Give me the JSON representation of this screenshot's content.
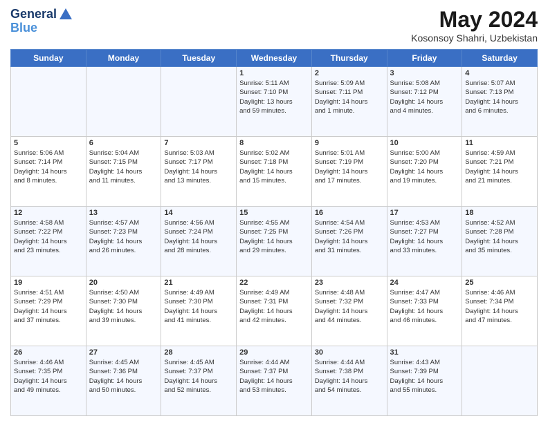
{
  "header": {
    "logo_line1": "General",
    "logo_line2": "Blue",
    "title": "May 2024",
    "subtitle": "Kosonsoy Shahri, Uzbekistan"
  },
  "weekdays": [
    "Sunday",
    "Monday",
    "Tuesday",
    "Wednesday",
    "Thursday",
    "Friday",
    "Saturday"
  ],
  "weeks": [
    [
      {
        "day": "",
        "info": ""
      },
      {
        "day": "",
        "info": ""
      },
      {
        "day": "",
        "info": ""
      },
      {
        "day": "1",
        "info": "Sunrise: 5:11 AM\nSunset: 7:10 PM\nDaylight: 13 hours\nand 59 minutes."
      },
      {
        "day": "2",
        "info": "Sunrise: 5:09 AM\nSunset: 7:11 PM\nDaylight: 14 hours\nand 1 minute."
      },
      {
        "day": "3",
        "info": "Sunrise: 5:08 AM\nSunset: 7:12 PM\nDaylight: 14 hours\nand 4 minutes."
      },
      {
        "day": "4",
        "info": "Sunrise: 5:07 AM\nSunset: 7:13 PM\nDaylight: 14 hours\nand 6 minutes."
      }
    ],
    [
      {
        "day": "5",
        "info": "Sunrise: 5:06 AM\nSunset: 7:14 PM\nDaylight: 14 hours\nand 8 minutes."
      },
      {
        "day": "6",
        "info": "Sunrise: 5:04 AM\nSunset: 7:15 PM\nDaylight: 14 hours\nand 11 minutes."
      },
      {
        "day": "7",
        "info": "Sunrise: 5:03 AM\nSunset: 7:17 PM\nDaylight: 14 hours\nand 13 minutes."
      },
      {
        "day": "8",
        "info": "Sunrise: 5:02 AM\nSunset: 7:18 PM\nDaylight: 14 hours\nand 15 minutes."
      },
      {
        "day": "9",
        "info": "Sunrise: 5:01 AM\nSunset: 7:19 PM\nDaylight: 14 hours\nand 17 minutes."
      },
      {
        "day": "10",
        "info": "Sunrise: 5:00 AM\nSunset: 7:20 PM\nDaylight: 14 hours\nand 19 minutes."
      },
      {
        "day": "11",
        "info": "Sunrise: 4:59 AM\nSunset: 7:21 PM\nDaylight: 14 hours\nand 21 minutes."
      }
    ],
    [
      {
        "day": "12",
        "info": "Sunrise: 4:58 AM\nSunset: 7:22 PM\nDaylight: 14 hours\nand 23 minutes."
      },
      {
        "day": "13",
        "info": "Sunrise: 4:57 AM\nSunset: 7:23 PM\nDaylight: 14 hours\nand 26 minutes."
      },
      {
        "day": "14",
        "info": "Sunrise: 4:56 AM\nSunset: 7:24 PM\nDaylight: 14 hours\nand 28 minutes."
      },
      {
        "day": "15",
        "info": "Sunrise: 4:55 AM\nSunset: 7:25 PM\nDaylight: 14 hours\nand 29 minutes."
      },
      {
        "day": "16",
        "info": "Sunrise: 4:54 AM\nSunset: 7:26 PM\nDaylight: 14 hours\nand 31 minutes."
      },
      {
        "day": "17",
        "info": "Sunrise: 4:53 AM\nSunset: 7:27 PM\nDaylight: 14 hours\nand 33 minutes."
      },
      {
        "day": "18",
        "info": "Sunrise: 4:52 AM\nSunset: 7:28 PM\nDaylight: 14 hours\nand 35 minutes."
      }
    ],
    [
      {
        "day": "19",
        "info": "Sunrise: 4:51 AM\nSunset: 7:29 PM\nDaylight: 14 hours\nand 37 minutes."
      },
      {
        "day": "20",
        "info": "Sunrise: 4:50 AM\nSunset: 7:30 PM\nDaylight: 14 hours\nand 39 minutes."
      },
      {
        "day": "21",
        "info": "Sunrise: 4:49 AM\nSunset: 7:30 PM\nDaylight: 14 hours\nand 41 minutes."
      },
      {
        "day": "22",
        "info": "Sunrise: 4:49 AM\nSunset: 7:31 PM\nDaylight: 14 hours\nand 42 minutes."
      },
      {
        "day": "23",
        "info": "Sunrise: 4:48 AM\nSunset: 7:32 PM\nDaylight: 14 hours\nand 44 minutes."
      },
      {
        "day": "24",
        "info": "Sunrise: 4:47 AM\nSunset: 7:33 PM\nDaylight: 14 hours\nand 46 minutes."
      },
      {
        "day": "25",
        "info": "Sunrise: 4:46 AM\nSunset: 7:34 PM\nDaylight: 14 hours\nand 47 minutes."
      }
    ],
    [
      {
        "day": "26",
        "info": "Sunrise: 4:46 AM\nSunset: 7:35 PM\nDaylight: 14 hours\nand 49 minutes."
      },
      {
        "day": "27",
        "info": "Sunrise: 4:45 AM\nSunset: 7:36 PM\nDaylight: 14 hours\nand 50 minutes."
      },
      {
        "day": "28",
        "info": "Sunrise: 4:45 AM\nSunset: 7:37 PM\nDaylight: 14 hours\nand 52 minutes."
      },
      {
        "day": "29",
        "info": "Sunrise: 4:44 AM\nSunset: 7:37 PM\nDaylight: 14 hours\nand 53 minutes."
      },
      {
        "day": "30",
        "info": "Sunrise: 4:44 AM\nSunset: 7:38 PM\nDaylight: 14 hours\nand 54 minutes."
      },
      {
        "day": "31",
        "info": "Sunrise: 4:43 AM\nSunset: 7:39 PM\nDaylight: 14 hours\nand 55 minutes."
      },
      {
        "day": "",
        "info": ""
      }
    ]
  ]
}
